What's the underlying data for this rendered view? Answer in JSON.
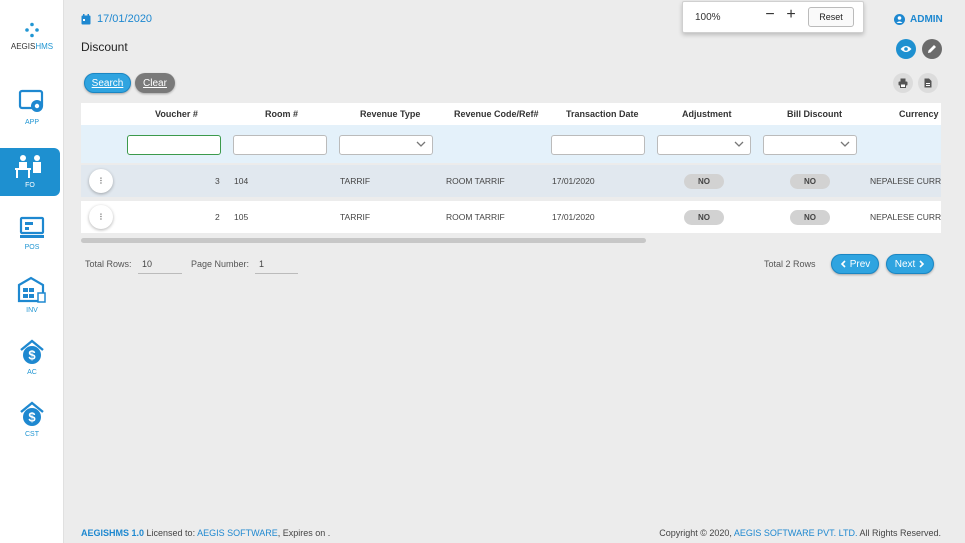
{
  "sidebar": {
    "logo": {
      "prefix": "AEGIS",
      "suffix": "HMS"
    },
    "items": [
      {
        "label": "APP",
        "icon": "app-settings-icon"
      },
      {
        "label": "FO",
        "icon": "front-office-icon"
      },
      {
        "label": "POS",
        "icon": "pos-icon"
      },
      {
        "label": "INV",
        "icon": "inventory-icon"
      },
      {
        "label": "AC",
        "icon": "accounts-icon"
      },
      {
        "label": "CST",
        "icon": "cost-icon"
      }
    ],
    "active": "FO"
  },
  "header": {
    "date": "17/01/2020",
    "title": "Discount",
    "user": "ADMIN"
  },
  "zoom": {
    "level": "100%",
    "minus": "−",
    "plus": "+",
    "reset_label": "Reset"
  },
  "toolbar": {
    "search_label": "Search",
    "clear_label": "Clear"
  },
  "grid": {
    "columns": [
      "Voucher #",
      "Room #",
      "Revenue Type",
      "Revenue Code/Ref#",
      "Transaction Date",
      "Adjustment",
      "Bill Discount",
      "Currency"
    ],
    "rows": [
      {
        "menu": "⁝",
        "voucher": "3",
        "room": "104",
        "revenue_type": "TARRIF",
        "revenue_code": "ROOM TARRIF",
        "date": "17/01/2020",
        "adjustment": "NO",
        "bill_discount": "NO",
        "currency": "NEPALESE CURRENCY"
      },
      {
        "menu": "⁝",
        "voucher": "2",
        "room": "105",
        "revenue_type": "TARRIF",
        "revenue_code": "ROOM TARRIF",
        "date": "17/01/2020",
        "adjustment": "NO",
        "bill_discount": "NO",
        "currency": "NEPALESE CURRENCY"
      }
    ]
  },
  "pagination": {
    "total_rows_label": "Total Rows:",
    "total_rows_value": "10",
    "page_number_label": "Page Number:",
    "page_number_value": "1",
    "total_text": "Total 2 Rows",
    "prev_label": "Prev",
    "next_label": "Next"
  },
  "footer": {
    "product": "AEGISHMS 1.0",
    "licensed_text": " Licensed to: ",
    "licensee": "AEGIS SOFTWARE",
    "expires_text": ", Expires on .",
    "copyright_text": "Copyright © 2020, ",
    "company": "AEGIS SOFTWARE PVT. LTD.",
    "rights_text": " All Rights Reserved."
  },
  "colors": {
    "accent": "#1e90d0",
    "sidebar_active": "#1e90d0",
    "background": "#ececec"
  }
}
